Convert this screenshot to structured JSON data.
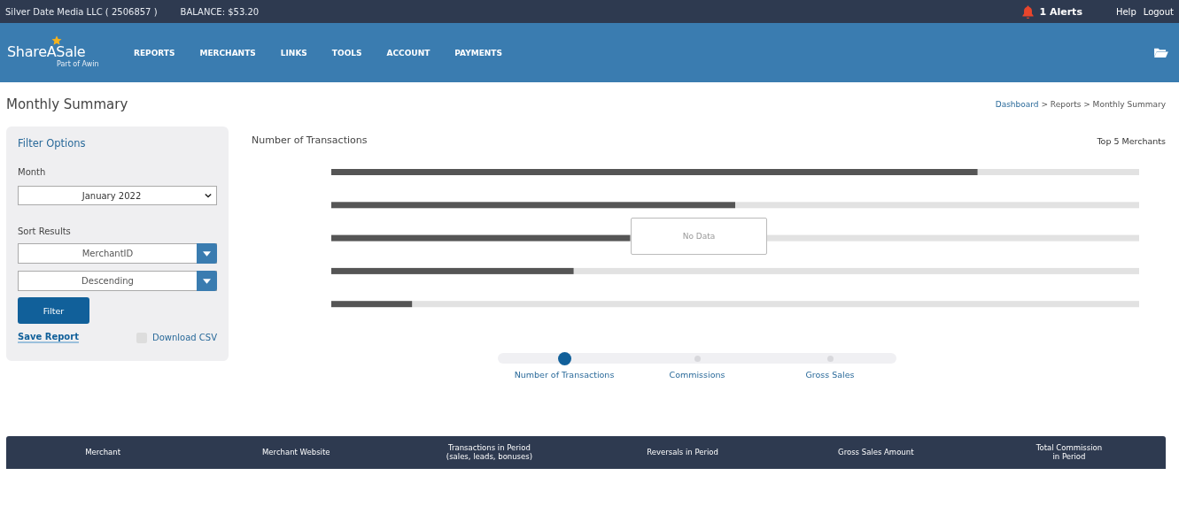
{
  "top_bar": {
    "account": "Silver Date Media LLC ( 2506857 )",
    "balance": "BALANCE: $53.20",
    "alerts": "1 Alerts",
    "links": [
      "Help",
      "Logout"
    ]
  },
  "header": {
    "logo": "ShareASale",
    "logo_sub": "Part of Awin",
    "nav": [
      "REPORTS",
      "MERCHANTS",
      "LINKS",
      "TOOLS",
      "ACCOUNT",
      "PAYMENTS"
    ]
  },
  "page_title": "Monthly Summary",
  "breadcrumb": {
    "link": "Dashboard",
    "rest": "> Reports > Monthly Summary"
  },
  "filter": {
    "title": "Filter Options",
    "month_label": "Month",
    "month": "January 2022",
    "sort_label": "Sort Results",
    "sort_by": "MerchantID",
    "order": "Descending",
    "button": "Filter",
    "save": "Save Report",
    "csv": {
      "label": "Download CSV",
      "checked": false
    }
  },
  "chart": {
    "title": "Number of Transactions",
    "subtitle": "Top 5 Merchants",
    "overlay": "No Data"
  },
  "metric_tabs": [
    {
      "label": "Number of Transactions",
      "selected": true
    },
    {
      "label": "Commissions",
      "selected": false
    },
    {
      "label": "Gross Sales",
      "selected": false
    }
  ],
  "table": {
    "columns": [
      "Merchant",
      "Merchant Website",
      "Transactions in Period\n(sales, leads, bonuses)",
      "Reversals in Period",
      "Gross Sales Amount",
      "Total Commission\nin Period"
    ]
  }
}
